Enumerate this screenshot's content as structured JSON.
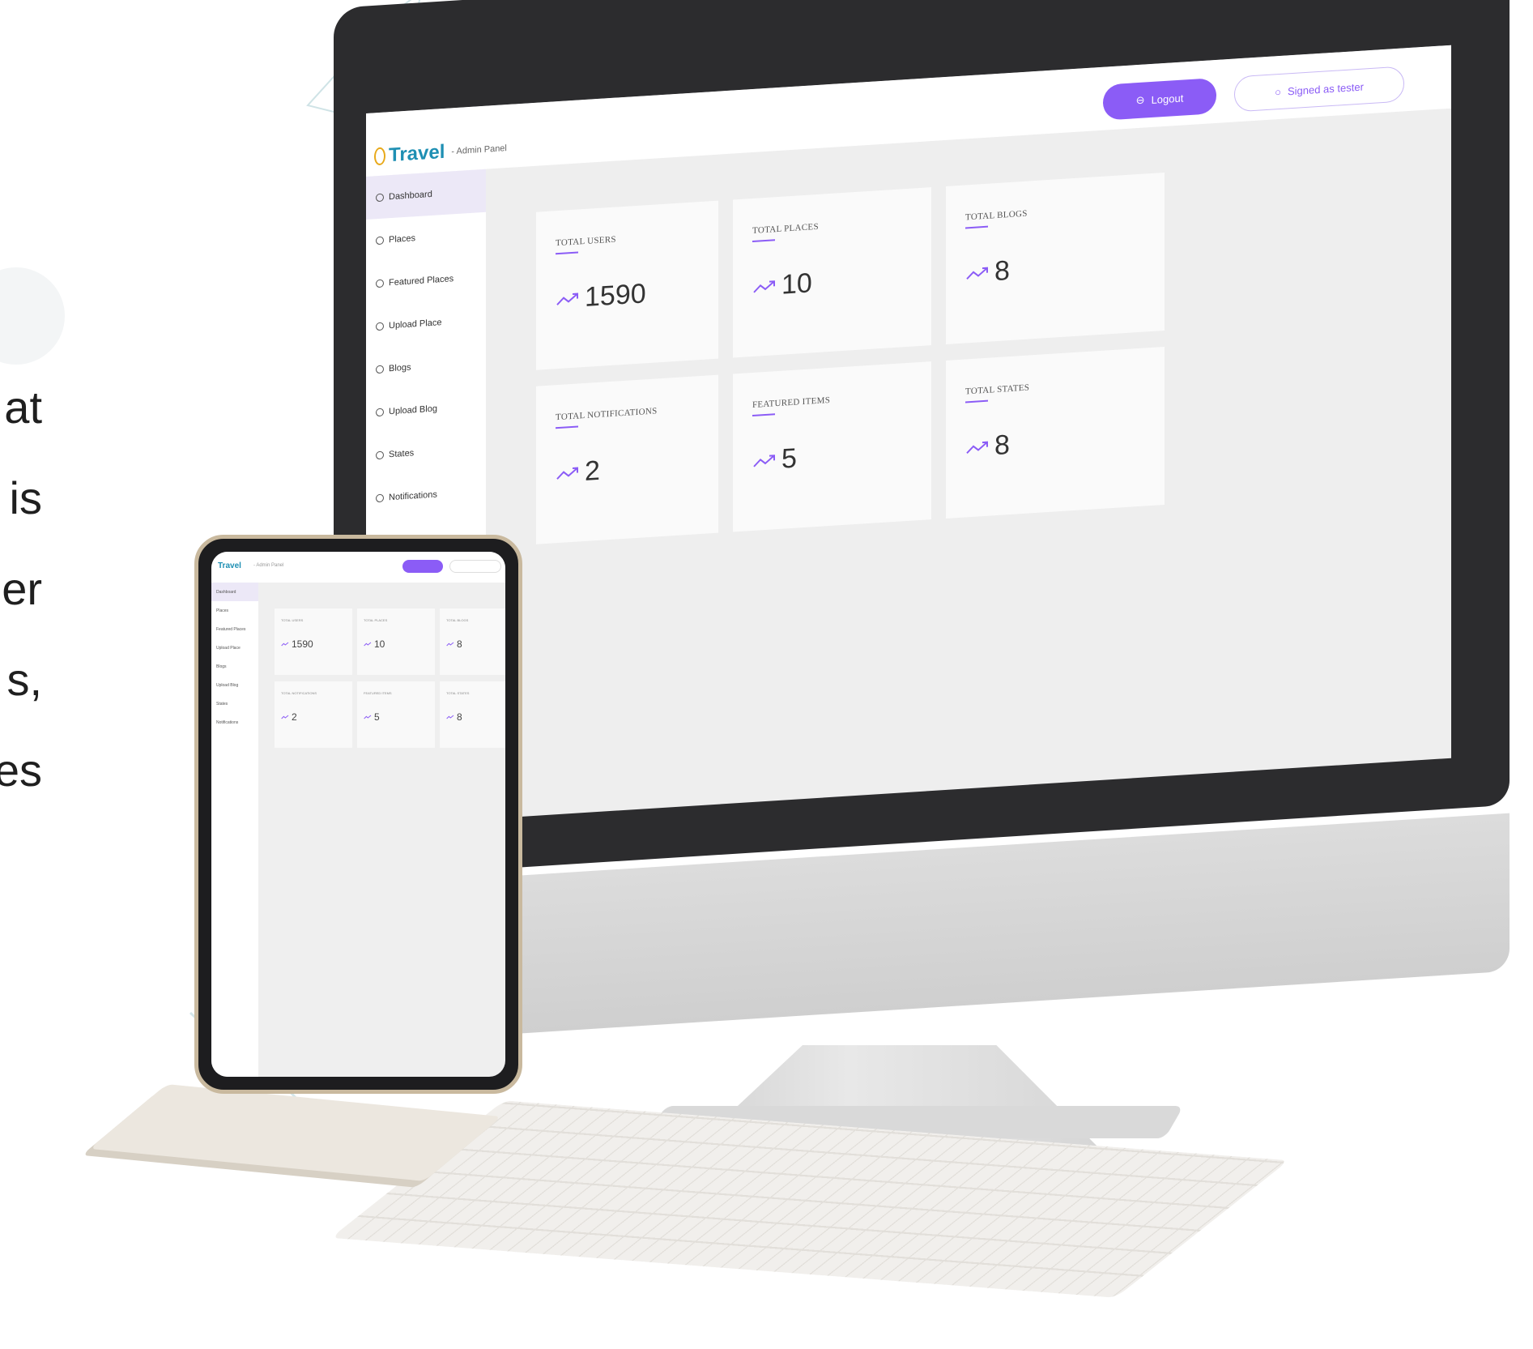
{
  "side_text": [
    "at",
    "is",
    "er",
    "s,",
    "es"
  ],
  "colors": {
    "accent": "#8b5cf6",
    "brand": "#1e8fb3",
    "brand_pin": "#e8a91a"
  },
  "app": {
    "brand_name": "Travel",
    "brand_subtitle": "- Admin Panel",
    "logout_label": "Logout",
    "signed_in_label": "Signed as tester"
  },
  "sidebar": {
    "items": [
      {
        "label": "Dashboard",
        "icon": "dashboard-icon",
        "active": true
      },
      {
        "label": "Places",
        "icon": "pin-icon"
      },
      {
        "label": "Featured Places",
        "icon": "star-icon"
      },
      {
        "label": "Upload Place",
        "icon": "upload-icon"
      },
      {
        "label": "Blogs",
        "icon": "pen-icon"
      },
      {
        "label": "Upload Blog",
        "icon": "upload-icon"
      },
      {
        "label": "States",
        "icon": "map-icon"
      },
      {
        "label": "Notifications",
        "icon": "bell-icon"
      }
    ]
  },
  "stats": [
    {
      "title": "TOTAL USERS",
      "value": "1590"
    },
    {
      "title": "TOTAL PLACES",
      "value": "10"
    },
    {
      "title": "TOTAL BLOGS",
      "value": "8"
    },
    {
      "title": "TOTAL NOTIFICATIONS",
      "value": "2"
    },
    {
      "title": "FEATURED ITEMS",
      "value": "5"
    },
    {
      "title": "TOTAL STATES",
      "value": "8"
    }
  ]
}
